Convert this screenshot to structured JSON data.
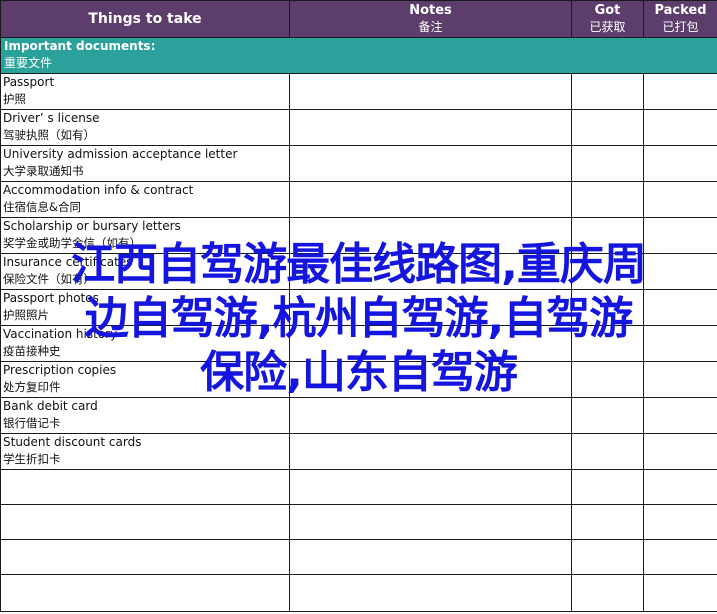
{
  "header": {
    "things": "Things to take",
    "notes_en": "Notes",
    "notes_zh": "备注",
    "got_en": "Got",
    "got_zh": "已获取",
    "packed_en": "Packed",
    "packed_zh": "已打包"
  },
  "section": {
    "en": "Important documents:",
    "zh": "重要文件"
  },
  "items": [
    {
      "en": "Passport",
      "zh": "护照"
    },
    {
      "en": "Driver’ s license",
      "zh": "驾驶执照（如有）"
    },
    {
      "en": "University admission acceptance letter",
      "zh": "大学录取通知书"
    },
    {
      "en": "Accommodation info & contract",
      "zh": "住宿信息&合同"
    },
    {
      "en": "Scholarship or bursary letters",
      "zh": "奖学金或助学金信（如有）"
    },
    {
      "en": "Insurance certificates",
      "zh": "保险文件（如有）"
    },
    {
      "en": "Passport photos",
      "zh": "护照照片"
    },
    {
      "en": "Vaccination history",
      "zh": "疫苗接种史"
    },
    {
      "en": "Prescription copies",
      "zh": "处方复印件"
    },
    {
      "en": "Bank debit card",
      "zh": "银行借记卡"
    },
    {
      "en": "Student discount cards",
      "zh": "学生折扣卡"
    }
  ],
  "overlay": {
    "line1": "江西自驾游最佳线路图,重庆周",
    "line2": "边自驾游,杭州自驾游,自驾游",
    "line3": "保险,山东自驾游"
  },
  "colors": {
    "header_bg": "#5c3d6b",
    "section_bg": "#2aa19a",
    "overlay_text": "#1515e0"
  }
}
